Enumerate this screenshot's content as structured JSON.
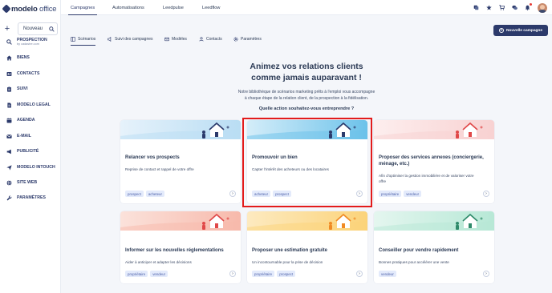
{
  "app": {
    "logo_bold": "modelo",
    "logo_light": " office"
  },
  "top_tabs": [
    {
      "label": "Campagnes",
      "active": true
    },
    {
      "label": "Automatisations",
      "active": false
    },
    {
      "label": "Leedpulse",
      "active": false
    },
    {
      "label": "Leedflow",
      "active": false
    }
  ],
  "top_icons": [
    "stack-icon",
    "star-icon",
    "cart-icon",
    "chat-icon",
    "bell-icon"
  ],
  "sidebar": {
    "new_plus": "+",
    "new_label": "Nouveau",
    "items": [
      {
        "label": "PROSPECTION",
        "sub": "by cadastre.com",
        "icon": "search-icon"
      },
      {
        "label": "BIENS",
        "icon": "home-icon"
      },
      {
        "label": "CONTACTS",
        "icon": "contact-card-icon"
      },
      {
        "label": "SUIVI",
        "icon": "clipboard-icon"
      },
      {
        "label": "MODELO LEGAL",
        "icon": "document-icon"
      },
      {
        "label": "AGENDA",
        "icon": "calendar-icon"
      },
      {
        "label": "E-MAIL",
        "icon": "mail-icon"
      },
      {
        "label": "PUBLICITÉ",
        "icon": "megaphone-icon"
      },
      {
        "label": "MODELO INTOUCH",
        "icon": "send-icon"
      },
      {
        "label": "SITE WEB",
        "icon": "globe-icon"
      },
      {
        "label": "PARAMÈTRES",
        "icon": "wrench-icon"
      }
    ]
  },
  "new_campaign": {
    "icon_glyph": "+",
    "label": "Nouvelle campagne"
  },
  "sub_tabs": [
    {
      "label": "Scénarios",
      "icon": "layout-icon",
      "active": true
    },
    {
      "label": "Suivi des campagnes",
      "icon": "speaker-icon",
      "active": false
    },
    {
      "label": "Modèles",
      "icon": "envelope-icon",
      "active": false
    },
    {
      "label": "Contacts",
      "icon": "users-icon",
      "active": false
    },
    {
      "label": "Paramètres",
      "icon": "gear-icon",
      "active": false
    }
  ],
  "hero": {
    "title_line1": "Animez vos relations clients",
    "title_line2": "comme jamais auparavant !",
    "desc_line1": "Notre bibliothèque de scénarios marketing prêts à l'emploi vous accompagne",
    "desc_line2": "à chaque étape de la relation client, de la prospection à la fidélisation.",
    "question": "Quelle action souhaitez-vous entreprendre ?"
  },
  "cards": [
    {
      "title_line1": "Relancer vos prospects",
      "title_line2": "",
      "desc_line1": "Reprise de contact et rappel de votre offre",
      "desc_line2": "",
      "tags": [
        "prospect",
        "acheteur"
      ],
      "arrow": "›",
      "banner_color": "#b9ddf3",
      "banner_color2": "#e6f2fb",
      "accent": "#2c3a6b",
      "highlighted": false
    },
    {
      "title_line1": "Promouvoir un bien",
      "title_line2": "",
      "desc_line1": "Capter l'intérêt des acheteurs ou des locataires",
      "desc_line2": "",
      "tags": [
        "acheteur",
        "prospect"
      ],
      "arrow": "›",
      "banner_color": "#6cc2ea",
      "banner_color2": "#d4edf9",
      "accent": "#2c3a6b",
      "highlighted": true
    },
    {
      "title_line1": "Proposer des services annexes (conciergerie,",
      "title_line2": "ménage, etc.)",
      "desc_line1": "Afin d'optimiser la gestion immobilière et de valoriser votre",
      "desc_line2": "offre",
      "tags": [
        "propriétaire",
        "vendeur"
      ],
      "arrow": "›",
      "banner_color": "#f8d2d2",
      "banner_color2": "#fdeeee",
      "accent": "#e04848",
      "highlighted": false
    },
    {
      "title_line1": "Informer sur les nouvelles réglementations",
      "title_line2": "",
      "desc_line1": "Aider à anticiper et adapter les décisions",
      "desc_line2": "",
      "tags": [
        "propriétaire",
        "vendeur"
      ],
      "arrow": "›",
      "banner_color": "#f7b9ab",
      "banner_color2": "#fbe2db",
      "accent": "#e04848",
      "highlighted": false
    },
    {
      "title_line1": "Proposer une estimation gratuite",
      "title_line2": "",
      "desc_line1": "Un incontournable pour la prise de décision",
      "desc_line2": "",
      "tags": [
        "propriétaire",
        "prospect"
      ],
      "arrow": "›",
      "banner_color": "#fbd37a",
      "banner_color2": "#fdeac0",
      "accent": "#f08a24",
      "highlighted": false
    },
    {
      "title_line1": "Conseiller pour vendre rapidement",
      "title_line2": "",
      "desc_line1": "Bonnes pratiques pour accélérer une vente",
      "desc_line2": "",
      "tags": [
        "vendeur"
      ],
      "arrow": "›",
      "banner_color": "#b7e8d6",
      "banner_color2": "#e4f6ef",
      "accent": "#2f8a6a",
      "highlighted": false
    }
  ]
}
